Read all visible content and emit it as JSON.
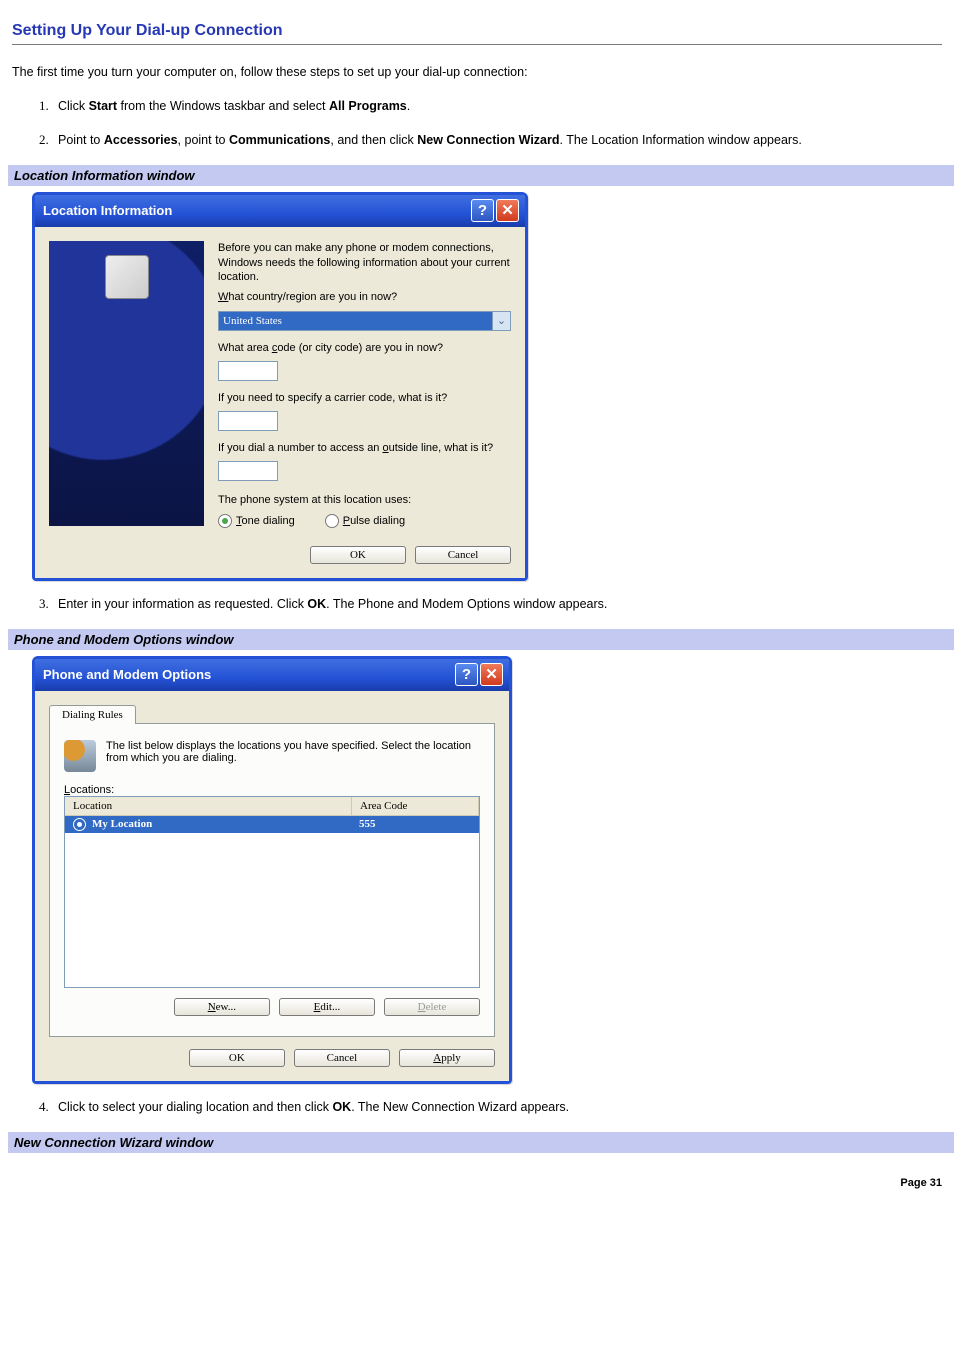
{
  "page": {
    "title": "Setting Up Your Dial-up Connection",
    "intro": "The first time you turn your computer on, follow these steps to set up your dial-up connection:",
    "footer": "Page 31"
  },
  "steps": {
    "s1_a": "Click ",
    "s1_b": "Start",
    "s1_c": " from the Windows taskbar and select ",
    "s1_d": "All Programs",
    "s1_e": ".",
    "s2_a": "Point to ",
    "s2_b": "Accessories",
    "s2_c": ", point to ",
    "s2_d": "Communications",
    "s2_e": ", and then click ",
    "s2_f": "New Connection Wizard",
    "s2_g": ". The Location Information window appears.",
    "s3_a": "Enter in your information as requested. Click ",
    "s3_b": "OK",
    "s3_c": ". The Phone and Modem Options window appears.",
    "s4_a": "Click to select your dialing location and then click ",
    "s4_b": "OK",
    "s4_c": ". The New Connection Wizard appears."
  },
  "captions": {
    "loc": "Location Information window",
    "pm": "Phone and Modem Options window",
    "ncw": "New Connection Wizard window"
  },
  "loc": {
    "title": "Location Information",
    "intro": "Before you can make any phone or modem connections, Windows needs the following information about your current location.",
    "q_country": "What country/region are you in now?",
    "country": "United States",
    "q_area": "What area code (or city code) are you in now?",
    "q_carrier": "If you need to specify a carrier code, what is it?",
    "q_outside": "If you dial a number to access an outside line, what is it?",
    "q_system": "The phone system at this location uses:",
    "tone": "Tone dialing",
    "pulse": "Pulse dialing",
    "ok": "OK",
    "cancel": "Cancel"
  },
  "pm": {
    "title": "Phone and Modem Options",
    "tab": "Dialing Rules",
    "desc": "The list below displays the locations you have specified. Select the location from which you are dialing.",
    "locations_label": "Locations:",
    "col_location": "Location",
    "col_area": "Area Code",
    "row_location": "My Location",
    "row_area": "555",
    "new": "New...",
    "edit": "Edit...",
    "delete": "Delete",
    "ok": "OK",
    "cancel": "Cancel",
    "apply": "Apply"
  },
  "access": {
    "N": "N",
    "E": "E",
    "D": "D",
    "A": "A",
    "L": "L",
    "W": "W",
    "c": "c",
    "o": "o",
    "T": "T",
    "P": "P"
  }
}
